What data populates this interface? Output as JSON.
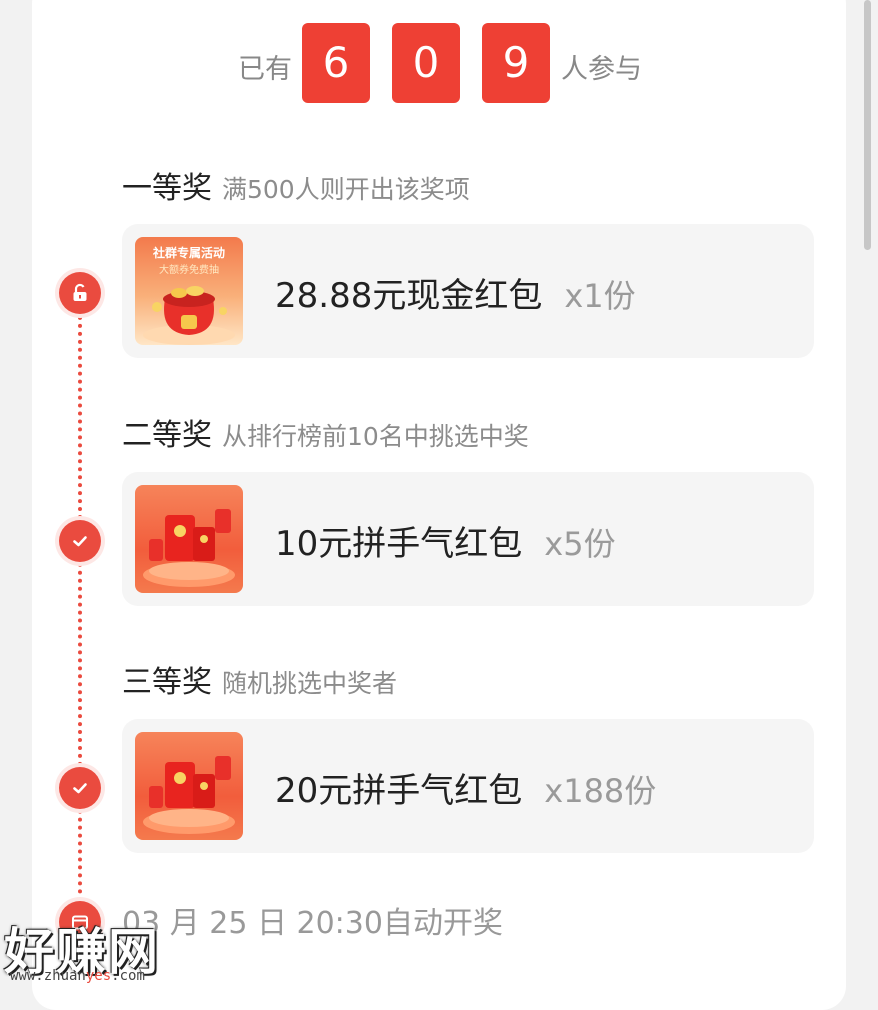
{
  "counter": {
    "prefix": "已有",
    "digits": [
      "6",
      "0",
      "9"
    ],
    "suffix": "人参与"
  },
  "prizes": [
    {
      "title": "一等奖",
      "condition": "满500人则开出该奖项",
      "thumb_line1": "社群专属活动",
      "thumb_line2": "大额券免费抽",
      "name": "28.88元现金红包",
      "qty": "x1份",
      "status_icon": "unlock-icon"
    },
    {
      "title": "二等奖",
      "condition": "从排行榜前10名中挑选中奖",
      "name": "10元拼手气红包",
      "qty": "x5份",
      "status_icon": "check-icon"
    },
    {
      "title": "三等奖",
      "condition": "随机挑选中奖者",
      "name": "20元拼手气红包",
      "qty": "x188份",
      "status_icon": "check-icon"
    }
  ],
  "draw_time": "03 月 25 日 20:30自动开奖",
  "watermark": {
    "text": "好赚网",
    "url_prefix": "www.zhuan",
    "url_highlight": "yes",
    "url_suffix": ".com"
  },
  "colors": {
    "accent": "#ea4b3f",
    "digit_bg": "#ee4034",
    "box_bg": "#f5f5f5"
  }
}
